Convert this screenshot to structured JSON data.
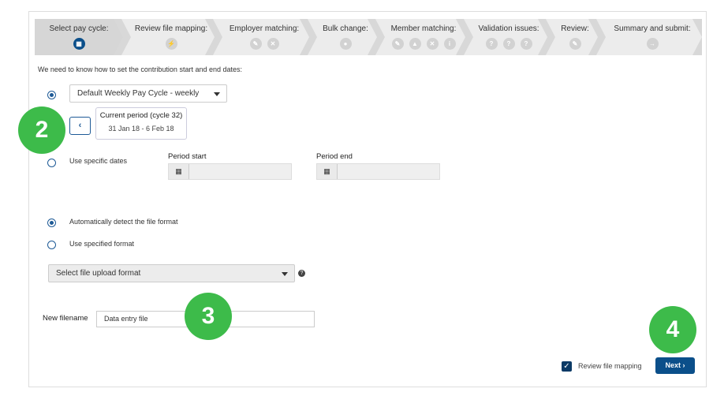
{
  "steps": [
    {
      "label": "Select pay cycle:",
      "icons": [
        "calendar-icon"
      ],
      "active": true
    },
    {
      "label": "Review file mapping:",
      "icons": [
        "plug-icon"
      ]
    },
    {
      "label": "Employer matching:",
      "icons": [
        "pencil-icon",
        "times-icon"
      ]
    },
    {
      "label": "Bulk change:",
      "icons": [
        "users-icon"
      ]
    },
    {
      "label": "Member matching:",
      "icons": [
        "pencil-icon",
        "warning-icon",
        "times-icon",
        "info-icon"
      ]
    },
    {
      "label": "Validation issues:",
      "icons": [
        "question-icon",
        "question-icon",
        "question-icon"
      ]
    },
    {
      "label": "Review:",
      "icons": [
        "edit-icon"
      ]
    },
    {
      "label": "Summary and submit:",
      "icons": [
        "arrow-right-icon"
      ]
    }
  ],
  "intro": "We need to know how to set the contribution start and end dates:",
  "pay_cycle": {
    "selected": "Default Weekly Pay Cycle - weekly",
    "current_period_title": "Current period (cycle 32)",
    "current_period_range": "31 Jan 18 - 6 Feb 18"
  },
  "specific_dates": {
    "label": "Use specific dates",
    "start_label": "Period start",
    "end_label": "Period end",
    "start_value": "",
    "end_value": ""
  },
  "format": {
    "auto_label": "Automatically detect the file format",
    "specified_label": "Use specified format",
    "select_placeholder": "Select file upload format"
  },
  "filename": {
    "label": "New filename",
    "value": "Data entry file"
  },
  "footer": {
    "review_checkbox_label": "Review file mapping",
    "review_checked": true,
    "next_label": "Next"
  },
  "badges": {
    "b2": "2",
    "b3": "3",
    "b4": "4"
  },
  "colors": {
    "primary": "#0b4f8a",
    "badge": "#3dbb4a"
  }
}
